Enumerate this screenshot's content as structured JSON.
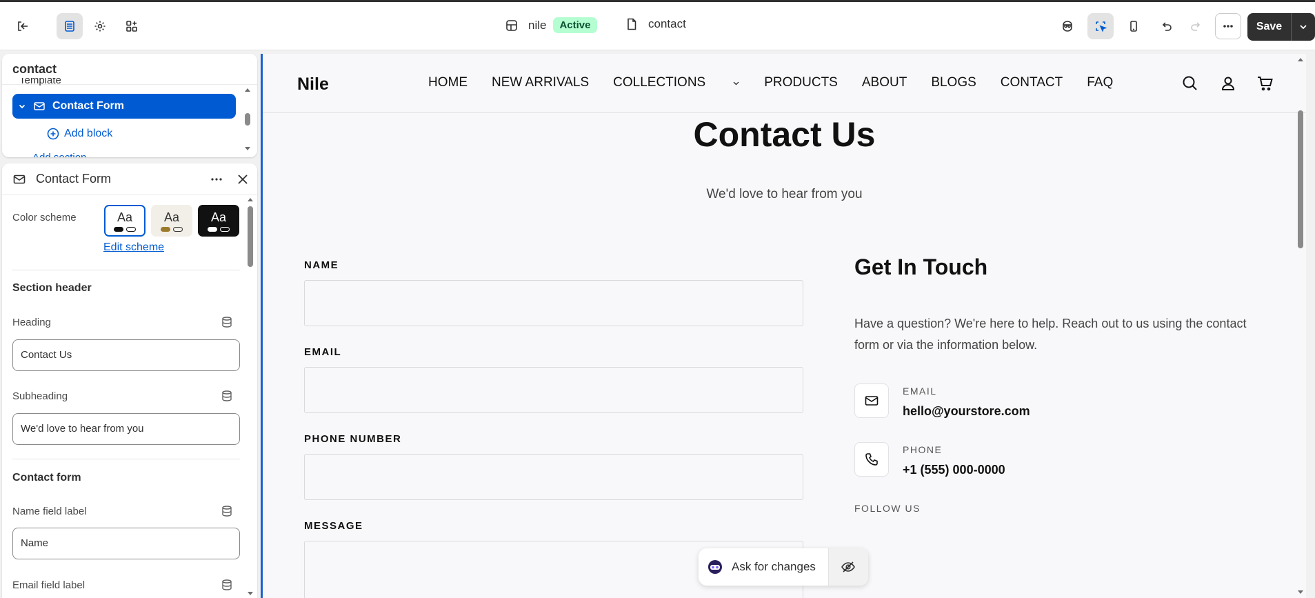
{
  "topbar": {
    "store_name": "nile",
    "store_status": "Active",
    "page_name": "contact",
    "save_label": "Save"
  },
  "tree": {
    "search_value": "contact",
    "partial_item": "Template",
    "selected_item": "Contact Form",
    "add_block_label": "Add block",
    "partial_bottom": "Add section"
  },
  "settings": {
    "panel_title": "Contact Form",
    "color_scheme_label": "Color scheme",
    "swatches": [
      "Aa",
      "Aa",
      "Aa"
    ],
    "edit_scheme_label": "Edit scheme",
    "section_header_title": "Section header",
    "heading_label": "Heading",
    "heading_value": "Contact Us",
    "subheading_label": "Subheading",
    "subheading_value": "We'd love to hear from you",
    "contact_form_title": "Contact form",
    "name_field_label": "Name field label",
    "name_field_value": "Name",
    "email_field_label": "Email field label"
  },
  "preview": {
    "logo": "Nile",
    "nav": [
      "HOME",
      "NEW ARRIVALS",
      "COLLECTIONS",
      "PRODUCTS",
      "ABOUT",
      "BLOGS",
      "CONTACT",
      "FAQ"
    ],
    "title": "Contact Us",
    "subtitle": "We'd love to hear from you",
    "form": {
      "name_label": "NAME",
      "email_label": "EMAIL",
      "phone_label": "PHONE NUMBER",
      "message_label": "MESSAGE"
    },
    "get_in_touch": {
      "title": "Get In Touch",
      "text": "Have a question? We're here to help. Reach out to us using the contact form or via the information below.",
      "email_label": "EMAIL",
      "email_value": "hello@yourstore.com",
      "phone_label": "PHONE",
      "phone_value": "+1 (555) 000-0000",
      "follow_label": "FOLLOW US"
    }
  },
  "ask": {
    "label": "Ask for changes"
  },
  "colors": {
    "accent": "#005bd3",
    "active_badge": "#b4fed2",
    "save_bg": "#303030"
  }
}
